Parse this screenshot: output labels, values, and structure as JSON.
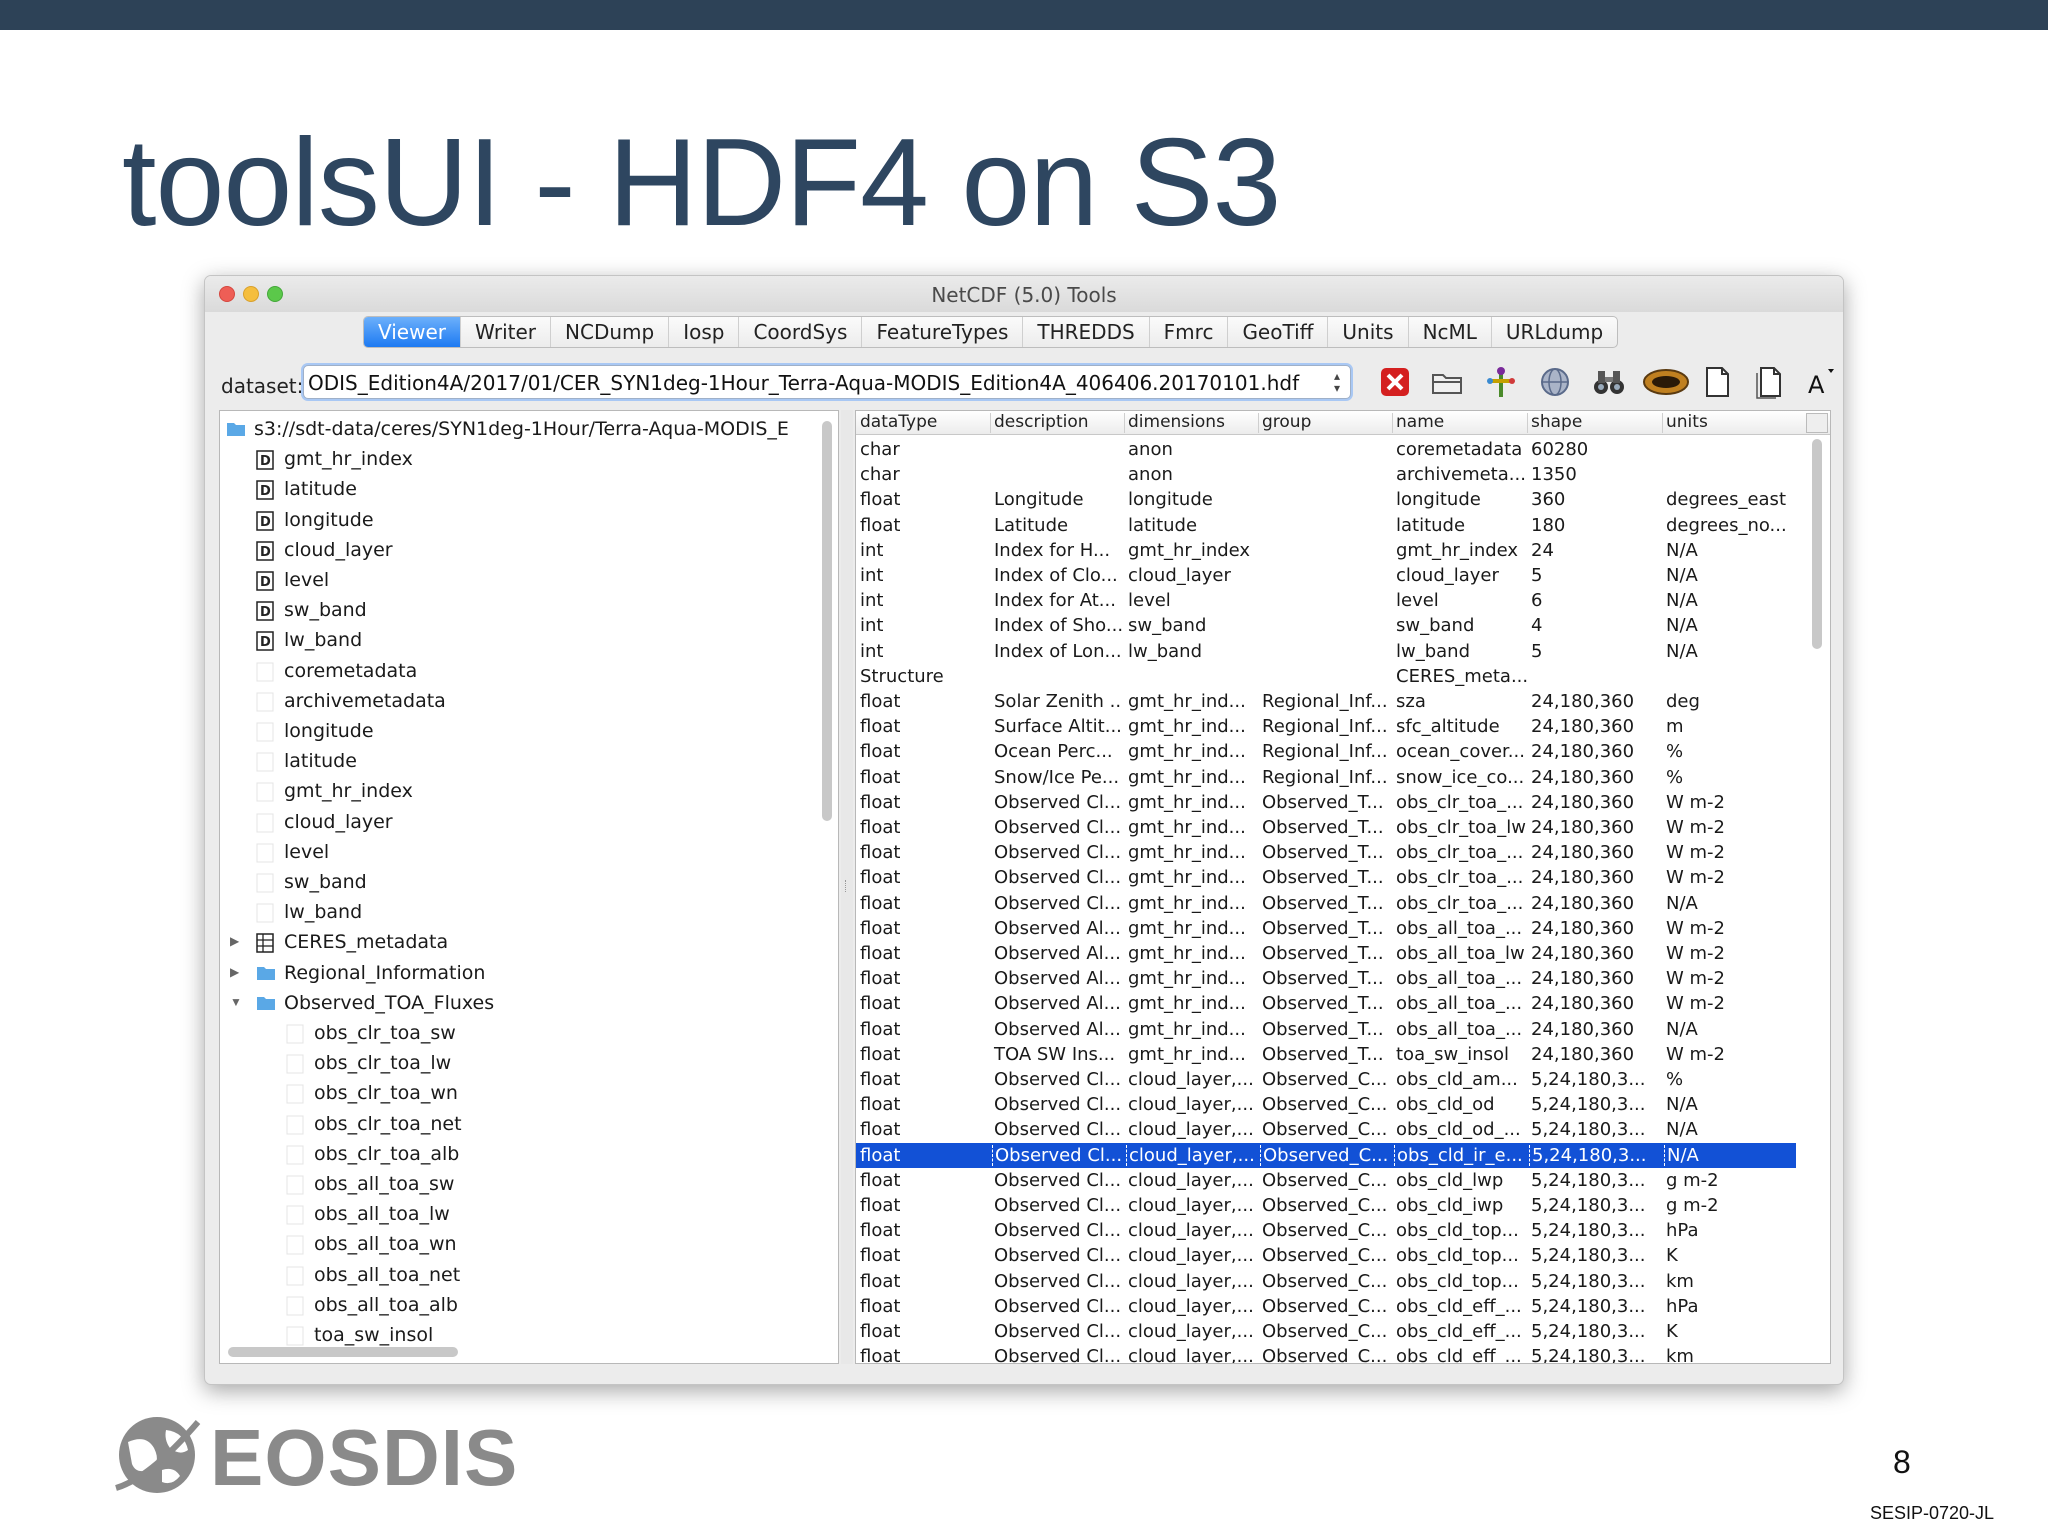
{
  "slide": {
    "title": "toolsUI - HDF4 on S3",
    "page_number": "8",
    "code": "SESIP-0720-JL",
    "logo_text": "EOSDIS"
  },
  "window": {
    "title": "NetCDF (5.0) Tools",
    "tabs": [
      {
        "label": "Viewer",
        "active": true
      },
      {
        "label": "Writer"
      },
      {
        "label": "NCDump"
      },
      {
        "label": "Iosp"
      },
      {
        "label": "CoordSys"
      },
      {
        "label": "FeatureTypes"
      },
      {
        "label": "THREDDS"
      },
      {
        "label": "Fmrc"
      },
      {
        "label": "GeoTiff"
      },
      {
        "label": "Units"
      },
      {
        "label": "NcML"
      },
      {
        "label": "URLdump"
      }
    ],
    "dataset_label": "dataset:",
    "dataset_value": "ODIS_Edition4A/2017/01/CER_SYN1deg-1Hour_Terra-Aqua-MODIS_Edition4A_406406.20170101.hdf",
    "toolbar_icons": [
      "close-dataset-icon",
      "open-folder-icon",
      "coord-sys-icon",
      "globe-icon",
      "binoculars-icon",
      "disk-icon",
      "document-icon",
      "document-copy-icon",
      "font-size-icon"
    ]
  },
  "tree": [
    {
      "label": "s3://sdt-data/ceres/SYN1deg-1Hour/Terra-Aqua-MODIS_E",
      "indent": 0,
      "icon": "folder"
    },
    {
      "label": "gmt_hr_index",
      "indent": 1,
      "icon": "dim"
    },
    {
      "label": "latitude",
      "indent": 1,
      "icon": "dim"
    },
    {
      "label": "longitude",
      "indent": 1,
      "icon": "dim"
    },
    {
      "label": "cloud_layer",
      "indent": 1,
      "icon": "dim"
    },
    {
      "label": "level",
      "indent": 1,
      "icon": "dim"
    },
    {
      "label": "sw_band",
      "indent": 1,
      "icon": "dim"
    },
    {
      "label": "lw_band",
      "indent": 1,
      "icon": "dim"
    },
    {
      "label": "coremetadata",
      "indent": 1,
      "icon": "var"
    },
    {
      "label": "archivemetadata",
      "indent": 1,
      "icon": "var"
    },
    {
      "label": "longitude",
      "indent": 1,
      "icon": "var"
    },
    {
      "label": "latitude",
      "indent": 1,
      "icon": "var"
    },
    {
      "label": "gmt_hr_index",
      "indent": 1,
      "icon": "var"
    },
    {
      "label": "cloud_layer",
      "indent": 1,
      "icon": "var"
    },
    {
      "label": "level",
      "indent": 1,
      "icon": "var"
    },
    {
      "label": "sw_band",
      "indent": 1,
      "icon": "var"
    },
    {
      "label": "lw_band",
      "indent": 1,
      "icon": "var"
    },
    {
      "label": "CERES_metadata",
      "indent": 1,
      "icon": "struct",
      "disclosure": "collapsed"
    },
    {
      "label": "Regional_Information",
      "indent": 1,
      "icon": "folder",
      "disclosure": "collapsed"
    },
    {
      "label": "Observed_TOA_Fluxes",
      "indent": 1,
      "icon": "folder",
      "disclosure": "expanded"
    },
    {
      "label": "obs_clr_toa_sw",
      "indent": 2,
      "icon": "var"
    },
    {
      "label": "obs_clr_toa_lw",
      "indent": 2,
      "icon": "var"
    },
    {
      "label": "obs_clr_toa_wn",
      "indent": 2,
      "icon": "var"
    },
    {
      "label": "obs_clr_toa_net",
      "indent": 2,
      "icon": "var"
    },
    {
      "label": "obs_clr_toa_alb",
      "indent": 2,
      "icon": "var"
    },
    {
      "label": "obs_all_toa_sw",
      "indent": 2,
      "icon": "var"
    },
    {
      "label": "obs_all_toa_lw",
      "indent": 2,
      "icon": "var"
    },
    {
      "label": "obs_all_toa_wn",
      "indent": 2,
      "icon": "var"
    },
    {
      "label": "obs_all_toa_net",
      "indent": 2,
      "icon": "var"
    },
    {
      "label": "obs_all_toa_alb",
      "indent": 2,
      "icon": "var"
    },
    {
      "label": "toa_sw_insol",
      "indent": 2,
      "icon": "var"
    }
  ],
  "table": {
    "columns": [
      "dataType",
      "description",
      "dimensions",
      "group",
      "name",
      "shape",
      "units"
    ],
    "rows": [
      [
        "char",
        "",
        "anon",
        "",
        "coremetadata",
        "60280",
        ""
      ],
      [
        "char",
        "",
        "anon",
        "",
        "archivemeta...",
        "1350",
        ""
      ],
      [
        "float",
        "Longitude",
        "longitude",
        "",
        "longitude",
        "360",
        "degrees_east"
      ],
      [
        "float",
        "Latitude",
        "latitude",
        "",
        "latitude",
        "180",
        "degrees_no..."
      ],
      [
        "int",
        "Index for H...",
        "gmt_hr_index",
        "",
        "gmt_hr_index",
        "24",
        "N/A"
      ],
      [
        "int",
        "Index of Clo...",
        "cloud_layer",
        "",
        "cloud_layer",
        "5",
        "N/A"
      ],
      [
        "int",
        "Index for At...",
        "level",
        "",
        "level",
        "6",
        "N/A"
      ],
      [
        "int",
        "Index of Sho...",
        "sw_band",
        "",
        "sw_band",
        "4",
        "N/A"
      ],
      [
        "int",
        "Index of Lon...",
        "lw_band",
        "",
        "lw_band",
        "5",
        "N/A"
      ],
      [
        "Structure",
        "",
        "",
        "",
        "CERES_meta...",
        "",
        ""
      ],
      [
        "float",
        "Solar Zenith ...",
        "gmt_hr_ind...",
        "Regional_Inf...",
        "sza",
        "24,180,360",
        "deg"
      ],
      [
        "float",
        "Surface Altit...",
        "gmt_hr_ind...",
        "Regional_Inf...",
        "sfc_altitude",
        "24,180,360",
        "m"
      ],
      [
        "float",
        "Ocean Perc...",
        "gmt_hr_ind...",
        "Regional_Inf...",
        "ocean_cover...",
        "24,180,360",
        "%"
      ],
      [
        "float",
        "Snow/Ice Pe...",
        "gmt_hr_ind...",
        "Regional_Inf...",
        "snow_ice_co...",
        "24,180,360",
        "%"
      ],
      [
        "float",
        "Observed Cl...",
        "gmt_hr_ind...",
        "Observed_T...",
        "obs_clr_toa_...",
        "24,180,360",
        "W m-2"
      ],
      [
        "float",
        "Observed Cl...",
        "gmt_hr_ind...",
        "Observed_T...",
        "obs_clr_toa_lw",
        "24,180,360",
        "W m-2"
      ],
      [
        "float",
        "Observed Cl...",
        "gmt_hr_ind...",
        "Observed_T...",
        "obs_clr_toa_...",
        "24,180,360",
        "W m-2"
      ],
      [
        "float",
        "Observed Cl...",
        "gmt_hr_ind...",
        "Observed_T...",
        "obs_clr_toa_...",
        "24,180,360",
        "W m-2"
      ],
      [
        "float",
        "Observed Cl...",
        "gmt_hr_ind...",
        "Observed_T...",
        "obs_clr_toa_...",
        "24,180,360",
        "N/A"
      ],
      [
        "float",
        "Observed Al...",
        "gmt_hr_ind...",
        "Observed_T...",
        "obs_all_toa_...",
        "24,180,360",
        "W m-2"
      ],
      [
        "float",
        "Observed Al...",
        "gmt_hr_ind...",
        "Observed_T...",
        "obs_all_toa_lw",
        "24,180,360",
        "W m-2"
      ],
      [
        "float",
        "Observed Al...",
        "gmt_hr_ind...",
        "Observed_T...",
        "obs_all_toa_...",
        "24,180,360",
        "W m-2"
      ],
      [
        "float",
        "Observed Al...",
        "gmt_hr_ind...",
        "Observed_T...",
        "obs_all_toa_...",
        "24,180,360",
        "W m-2"
      ],
      [
        "float",
        "Observed Al...",
        "gmt_hr_ind...",
        "Observed_T...",
        "obs_all_toa_...",
        "24,180,360",
        "N/A"
      ],
      [
        "float",
        "TOA SW Ins...",
        "gmt_hr_ind...",
        "Observed_T...",
        "toa_sw_insol",
        "24,180,360",
        "W m-2"
      ],
      [
        "float",
        "Observed Cl...",
        "cloud_layer,...",
        "Observed_C...",
        "obs_cld_am...",
        "5,24,180,3...",
        "%"
      ],
      [
        "float",
        "Observed Cl...",
        "cloud_layer,...",
        "Observed_C...",
        "obs_cld_od",
        "5,24,180,3...",
        "N/A"
      ],
      [
        "float",
        "Observed Cl...",
        "cloud_layer,...",
        "Observed_C...",
        "obs_cld_od_...",
        "5,24,180,3...",
        "N/A"
      ],
      [
        "float",
        "Observed Cl...",
        "cloud_layer,...",
        "Observed_C...",
        "obs_cld_ir_e...",
        "5,24,180,3...",
        "N/A"
      ],
      [
        "float",
        "Observed Cl...",
        "cloud_layer,...",
        "Observed_C...",
        "obs_cld_lwp",
        "5,24,180,3...",
        "g m-2"
      ],
      [
        "float",
        "Observed Cl...",
        "cloud_layer,...",
        "Observed_C...",
        "obs_cld_iwp",
        "5,24,180,3...",
        "g m-2"
      ],
      [
        "float",
        "Observed Cl...",
        "cloud_layer,...",
        "Observed_C...",
        "obs_cld_top...",
        "5,24,180,3...",
        "hPa"
      ],
      [
        "float",
        "Observed Cl...",
        "cloud_layer,...",
        "Observed_C...",
        "obs_cld_top...",
        "5,24,180,3...",
        "K"
      ],
      [
        "float",
        "Observed Cl...",
        "cloud_layer,...",
        "Observed_C...",
        "obs_cld_top...",
        "5,24,180,3...",
        "km"
      ],
      [
        "float",
        "Observed Cl...",
        "cloud_layer,...",
        "Observed_C...",
        "obs_cld_eff_...",
        "5,24,180,3...",
        "hPa"
      ],
      [
        "float",
        "Observed Cl...",
        "cloud_layer,...",
        "Observed_C...",
        "obs_cld_eff_...",
        "5,24,180,3...",
        "K"
      ],
      [
        "float",
        "Observed Cl...",
        "cloud_layer,...",
        "Observed_C...",
        "obs_cld_eff_...",
        "5,24,180,3...",
        "km"
      ]
    ],
    "selected_row": 28
  },
  "colors": {
    "title": "#2e4660",
    "top_bar": "#2d4257",
    "selection": "#1251d6",
    "active_tab": "#1d7af2"
  }
}
